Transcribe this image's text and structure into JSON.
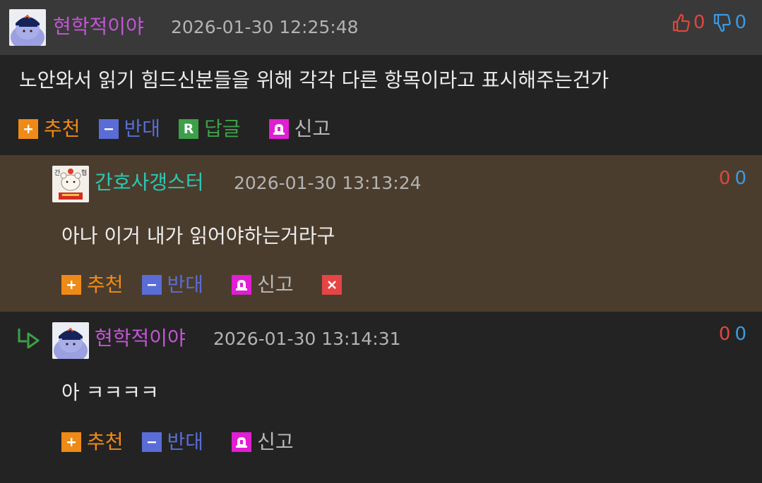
{
  "comments": [
    {
      "nickname": "현학적이야",
      "datetime": "2026-01-30 12:25:48",
      "up_count": "0",
      "down_count": "0",
      "text": "노안와서 읽기 힘드신분들을 위해 각각 다른 항목이라고 표시해주는건가",
      "actions": {
        "recommend": "추천",
        "oppose": "반대",
        "reply": "답글",
        "report": "신고"
      }
    },
    {
      "nickname": "간호사갱스터",
      "datetime": "2026-01-30 13:13:24",
      "up_count": "0",
      "down_count": "0",
      "text": "아나 이거 내가 읽어야하는거라구",
      "actions": {
        "recommend": "추천",
        "oppose": "반대",
        "report": "신고"
      }
    },
    {
      "nickname": "현학적이야",
      "datetime": "2026-01-30 13:14:31",
      "up_count": "0",
      "down_count": "0",
      "text": "아 ㅋㅋㅋㅋ",
      "actions": {
        "recommend": "추천",
        "oppose": "반대",
        "report": "신고"
      }
    }
  ],
  "avatar_text": {
    "left": "간",
    "right": "협"
  },
  "colors": {
    "background": "#232323",
    "header_bar": "#393939",
    "highlight_bg": "#4b3d2d",
    "nick_purple": "#c455d6",
    "nick_teal": "#2ec7b4",
    "up_red": "#e0473f",
    "down_blue": "#3a9ae4",
    "recommend_orange": "#f08a16",
    "oppose_blue": "#5a6cd6",
    "reply_green": "#3da048",
    "report_magenta": "#e01ed3",
    "delete_red": "#e64545"
  },
  "icons": [
    "thumbs-up-icon",
    "thumbs-down-icon",
    "plus-icon",
    "minus-icon",
    "reply-icon",
    "report-bell-icon",
    "delete-icon",
    "reply-arrow-icon"
  ]
}
